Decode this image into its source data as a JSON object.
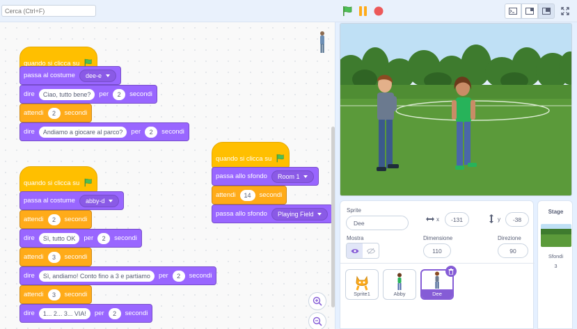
{
  "search": {
    "placeholder": "Cerca (Ctrl+F)"
  },
  "colors": {
    "events": "#ffbf00",
    "looks": "#9966ff",
    "control": "#ffab19",
    "accent": "#855cd6"
  },
  "scripts": [
    {
      "hat": {
        "text": "quando si clicca su",
        "icon": "green-flag-icon"
      },
      "blocks": [
        {
          "pre": "passa al costume",
          "menu": "dee-e"
        },
        {
          "pre": "dire",
          "msg": "Ciao, tutto bene?",
          "mid": "per",
          "num": "2",
          "post": "secondi"
        },
        {
          "pre": "attendi",
          "num": "2",
          "post": "secondi"
        },
        {
          "pre": "dire",
          "msg": "Andiamo a giocare al parco?",
          "mid": "per",
          "num": "2",
          "post": "secondi"
        }
      ]
    },
    {
      "hat": {
        "text": "quando si clicca su",
        "icon": "green-flag-icon"
      },
      "blocks": [
        {
          "pre": "passa al costume",
          "menu": "abby-d"
        },
        {
          "pre": "attendi",
          "num": "2",
          "post": "secondi"
        },
        {
          "pre": "dire",
          "msg": "Sì, tutto OK",
          "mid": "per",
          "num": "2",
          "post": "secondi"
        },
        {
          "pre": "attendi",
          "num": "3",
          "post": "secondi"
        },
        {
          "pre": "dire",
          "msg": "Sì, andiamo! Conto fino a 3 e partiamo",
          "mid": "per",
          "num": "2",
          "post": "secondi"
        },
        {
          "pre": "attendi",
          "num": "3",
          "post": "secondi"
        },
        {
          "pre": "dire",
          "msg": "1... 2... 3... VIA!",
          "mid": "per",
          "num": "2",
          "post": "secondi"
        }
      ]
    },
    {
      "hat": {
        "text": "quando si clicca su",
        "icon": "green-flag-icon"
      },
      "blocks": [
        {
          "pre": "passa allo sfondo",
          "menu": "Room 1"
        },
        {
          "pre": "attendi",
          "num": "14",
          "post": "secondi"
        },
        {
          "pre": "passa allo sfondo",
          "menu": "Playing Field"
        }
      ]
    }
  ],
  "sprite_info": {
    "sprite_label": "Sprite",
    "name": "Dee",
    "x_label": "x",
    "x": "-131",
    "y_label": "y",
    "y": "-38",
    "show_label": "Mostra",
    "size_label": "Dimensione",
    "size": "110",
    "direction_label": "Direzione",
    "direction": "90"
  },
  "sprites": [
    {
      "name": "Sprite1"
    },
    {
      "name": "Abby"
    },
    {
      "name": "Dee",
      "selected": true
    }
  ],
  "stage_panel": {
    "title": "Stage",
    "backdrops_label": "Sfondi",
    "backdrops_count": "3"
  }
}
